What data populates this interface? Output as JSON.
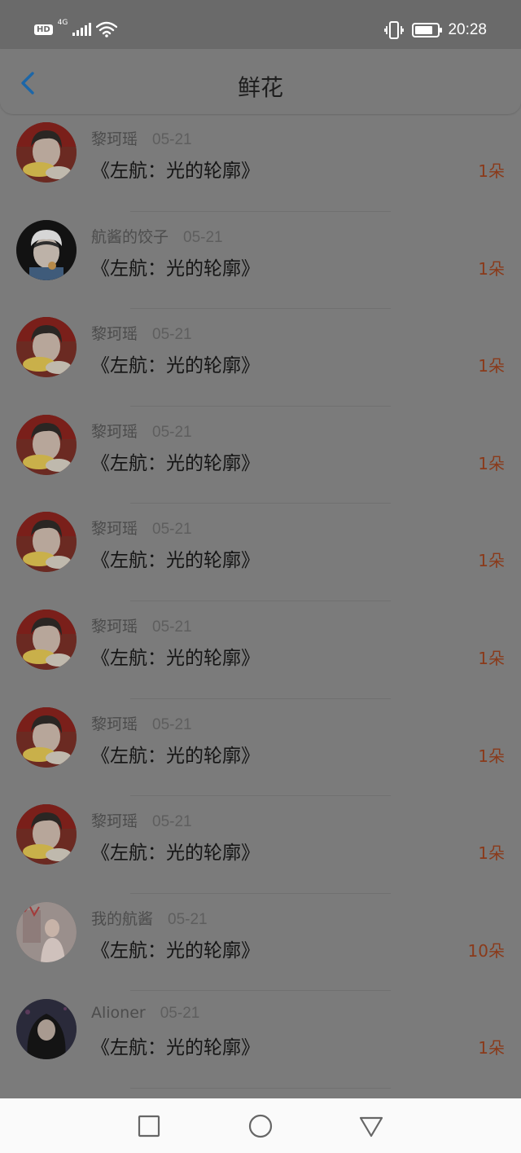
{
  "status_bar": {
    "hd": "HD",
    "network": "4G",
    "time": "20:28",
    "battery_level": 0.8,
    "vibrate_mode": true,
    "wifi_connected": true
  },
  "header": {
    "back_icon": "chevron-left-icon",
    "title": "鲜花"
  },
  "colors": {
    "accent": "#1c66a8",
    "count_text": "#8a3a1a",
    "overlay": "#7b7b7b"
  },
  "gifts": [
    {
      "user": "黎珂瑶",
      "date": "05-21",
      "book": "《左航：光的轮廓》",
      "count": "1朵",
      "avatar": "avatar-red-girl"
    },
    {
      "user": "航酱的饺子",
      "date": "05-21",
      "book": "《左航：光的轮廓》",
      "count": "1朵",
      "avatar": "avatar-boy-black"
    },
    {
      "user": "黎珂瑶",
      "date": "05-21",
      "book": "《左航：光的轮廓》",
      "count": "1朵",
      "avatar": "avatar-red-girl"
    },
    {
      "user": "黎珂瑶",
      "date": "05-21",
      "book": "《左航：光的轮廓》",
      "count": "1朵",
      "avatar": "avatar-red-girl"
    },
    {
      "user": "黎珂瑶",
      "date": "05-21",
      "book": "《左航：光的轮廓》",
      "count": "1朵",
      "avatar": "avatar-red-girl"
    },
    {
      "user": "黎珂瑶",
      "date": "05-21",
      "book": "《左航：光的轮廓》",
      "count": "1朵",
      "avatar": "avatar-red-girl"
    },
    {
      "user": "黎珂瑶",
      "date": "05-21",
      "book": "《左航：光的轮廓》",
      "count": "1朵",
      "avatar": "avatar-red-girl"
    },
    {
      "user": "黎珂瑶",
      "date": "05-21",
      "book": "《左航：光的轮廓》",
      "count": "1朵",
      "avatar": "avatar-red-girl"
    },
    {
      "user": "我的航酱",
      "date": "05-21",
      "book": "《左航：光的轮廓》",
      "count": "10朵",
      "avatar": "avatar-pink-room"
    },
    {
      "user": "Alioner",
      "date": "05-21",
      "book": "《左航：光的轮廓》",
      "count": "1朵",
      "avatar": "avatar-dark-hair"
    }
  ],
  "system_nav": {
    "recent": "square-icon",
    "home": "circle-icon",
    "back": "triangle-back-icon"
  }
}
